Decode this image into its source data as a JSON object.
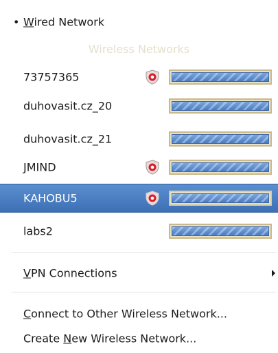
{
  "wired": {
    "bullet": "•",
    "mnemonic": "W",
    "label_rest": "ired Network"
  },
  "wireless_header": "Wireless Networks",
  "networks": [
    {
      "name": "73757365",
      "secured": true,
      "signal": 1.0
    },
    {
      "name": "duhovasit.cz_20",
      "secured": false,
      "signal": 1.0
    },
    {
      "name": "duhovasit.cz_21",
      "secured": false,
      "signal": 1.0
    },
    {
      "name": "JMIND",
      "secured": true,
      "signal": 1.0
    },
    {
      "name": "KAHOBU5",
      "secured": true,
      "signal": 1.0,
      "selected": true
    },
    {
      "name": "labs2",
      "secured": false,
      "signal": 1.0
    }
  ],
  "vpn": {
    "mnemonic": "V",
    "label_rest": "PN Connections"
  },
  "connect_other": {
    "mnemonic": "C",
    "label_rest": "onnect to Other Wireless Network..."
  },
  "create_new": {
    "label_before": "Create ",
    "mnemonic": "N",
    "label_after": "ew Wireless Network..."
  },
  "colors": {
    "selected_bg": "#4a7cc2",
    "header_text": "#e4e0cc",
    "signal_fill": "#5a8ad0",
    "shield_red": "#d0202a"
  },
  "icons": {
    "secured": "shield-lock-icon",
    "submenu": "submenu-arrow-icon"
  }
}
